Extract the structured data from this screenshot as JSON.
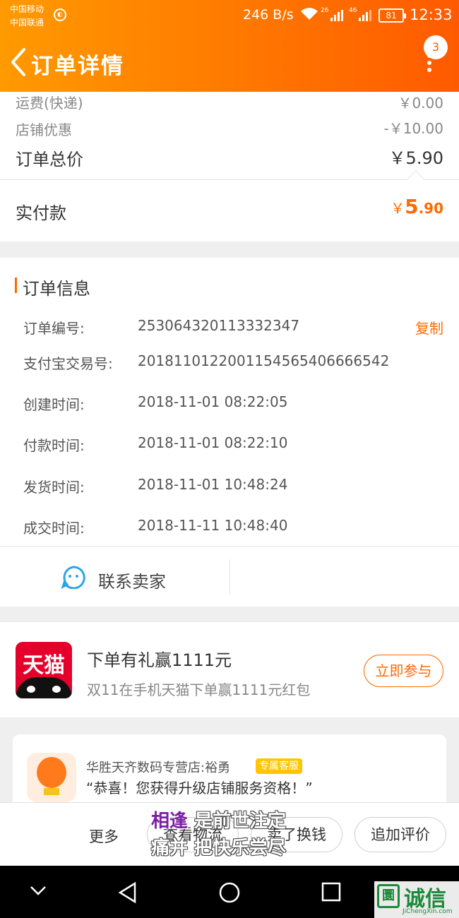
{
  "status_bar": {
    "carrier1": "中国移动",
    "carrier2": "中国联通",
    "speed": "246 B/s",
    "sig1": "26",
    "sig2": "46",
    "battery": "81",
    "time": "12:33"
  },
  "header": {
    "title": "订单详情",
    "badge": "3"
  },
  "price_summary": {
    "rows": [
      {
        "label": "运费(快递)",
        "value": "￥0.00"
      },
      {
        "label": "店铺优惠",
        "value": "-￥10.00"
      }
    ],
    "total_label": "订单总价",
    "total_value": "￥5.90",
    "paid_label": "实付款",
    "paid_symbol": "￥",
    "paid_int": "5",
    "paid_dec": ".90"
  },
  "order_info": {
    "title": "订单信息",
    "copy_label": "复制",
    "rows": [
      {
        "label": "订单编号:",
        "value": "253064320113332347"
      },
      {
        "label": "支付宝交易号:",
        "value": "2018110122001154565406666542"
      },
      {
        "label": "创建时间:",
        "value": "2018-11-01 08:22:05"
      },
      {
        "label": "付款时间:",
        "value": "2018-11-01 08:22:10"
      },
      {
        "label": "发货时间:",
        "value": "2018-11-01 10:48:24"
      },
      {
        "label": "成交时间:",
        "value": "2018-11-11 10:48:40"
      }
    ]
  },
  "contact": {
    "label": "联系卖家"
  },
  "promo": {
    "logo_text": "天猫",
    "title": "下单有礼赢1111元",
    "subtitle": "双11在手机天猫下单赢1111元红包",
    "button": "立即参与"
  },
  "service": {
    "store": "华胜天齐数码专营店:裕勇",
    "tag": "专属客服",
    "message": "“恭喜！您获得升级店铺服务资格！”"
  },
  "actions": {
    "more": "更多",
    "logistics": "查看物流",
    "sell": "卖了换钱",
    "review": "追加评价"
  },
  "overlay": {
    "line1_highlight": "相逢",
    "line1_rest": "是前世注定",
    "line2": "痛并 把快乐尝尽"
  },
  "watermark": {
    "mark": "圜",
    "text": "诚信",
    "url": "JiChengXin.com"
  },
  "colors": {
    "accent": "#ff6a00",
    "header_start": "#ff9a00",
    "header_end": "#ff5a00",
    "tmall_red": "#e4002b"
  }
}
